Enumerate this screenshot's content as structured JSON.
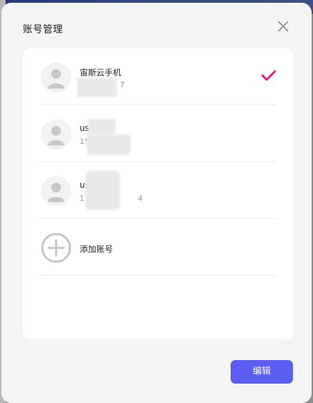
{
  "dialog": {
    "title": "账号管理",
    "close_icon": "close-icon",
    "edit_label": "编辑",
    "accent_color": "#5b5ef2",
    "check_color": "#e8177d"
  },
  "accounts": [
    {
      "name": "宙斯云手机",
      "sub": "7",
      "selected": true
    },
    {
      "name": "us",
      "sub": "15",
      "selected": false
    },
    {
      "name": "us",
      "sub": "1",
      "sub_tail": "4",
      "selected": false
    }
  ],
  "add_account": {
    "label": "添加账号",
    "icon": "plus-circle-icon"
  }
}
